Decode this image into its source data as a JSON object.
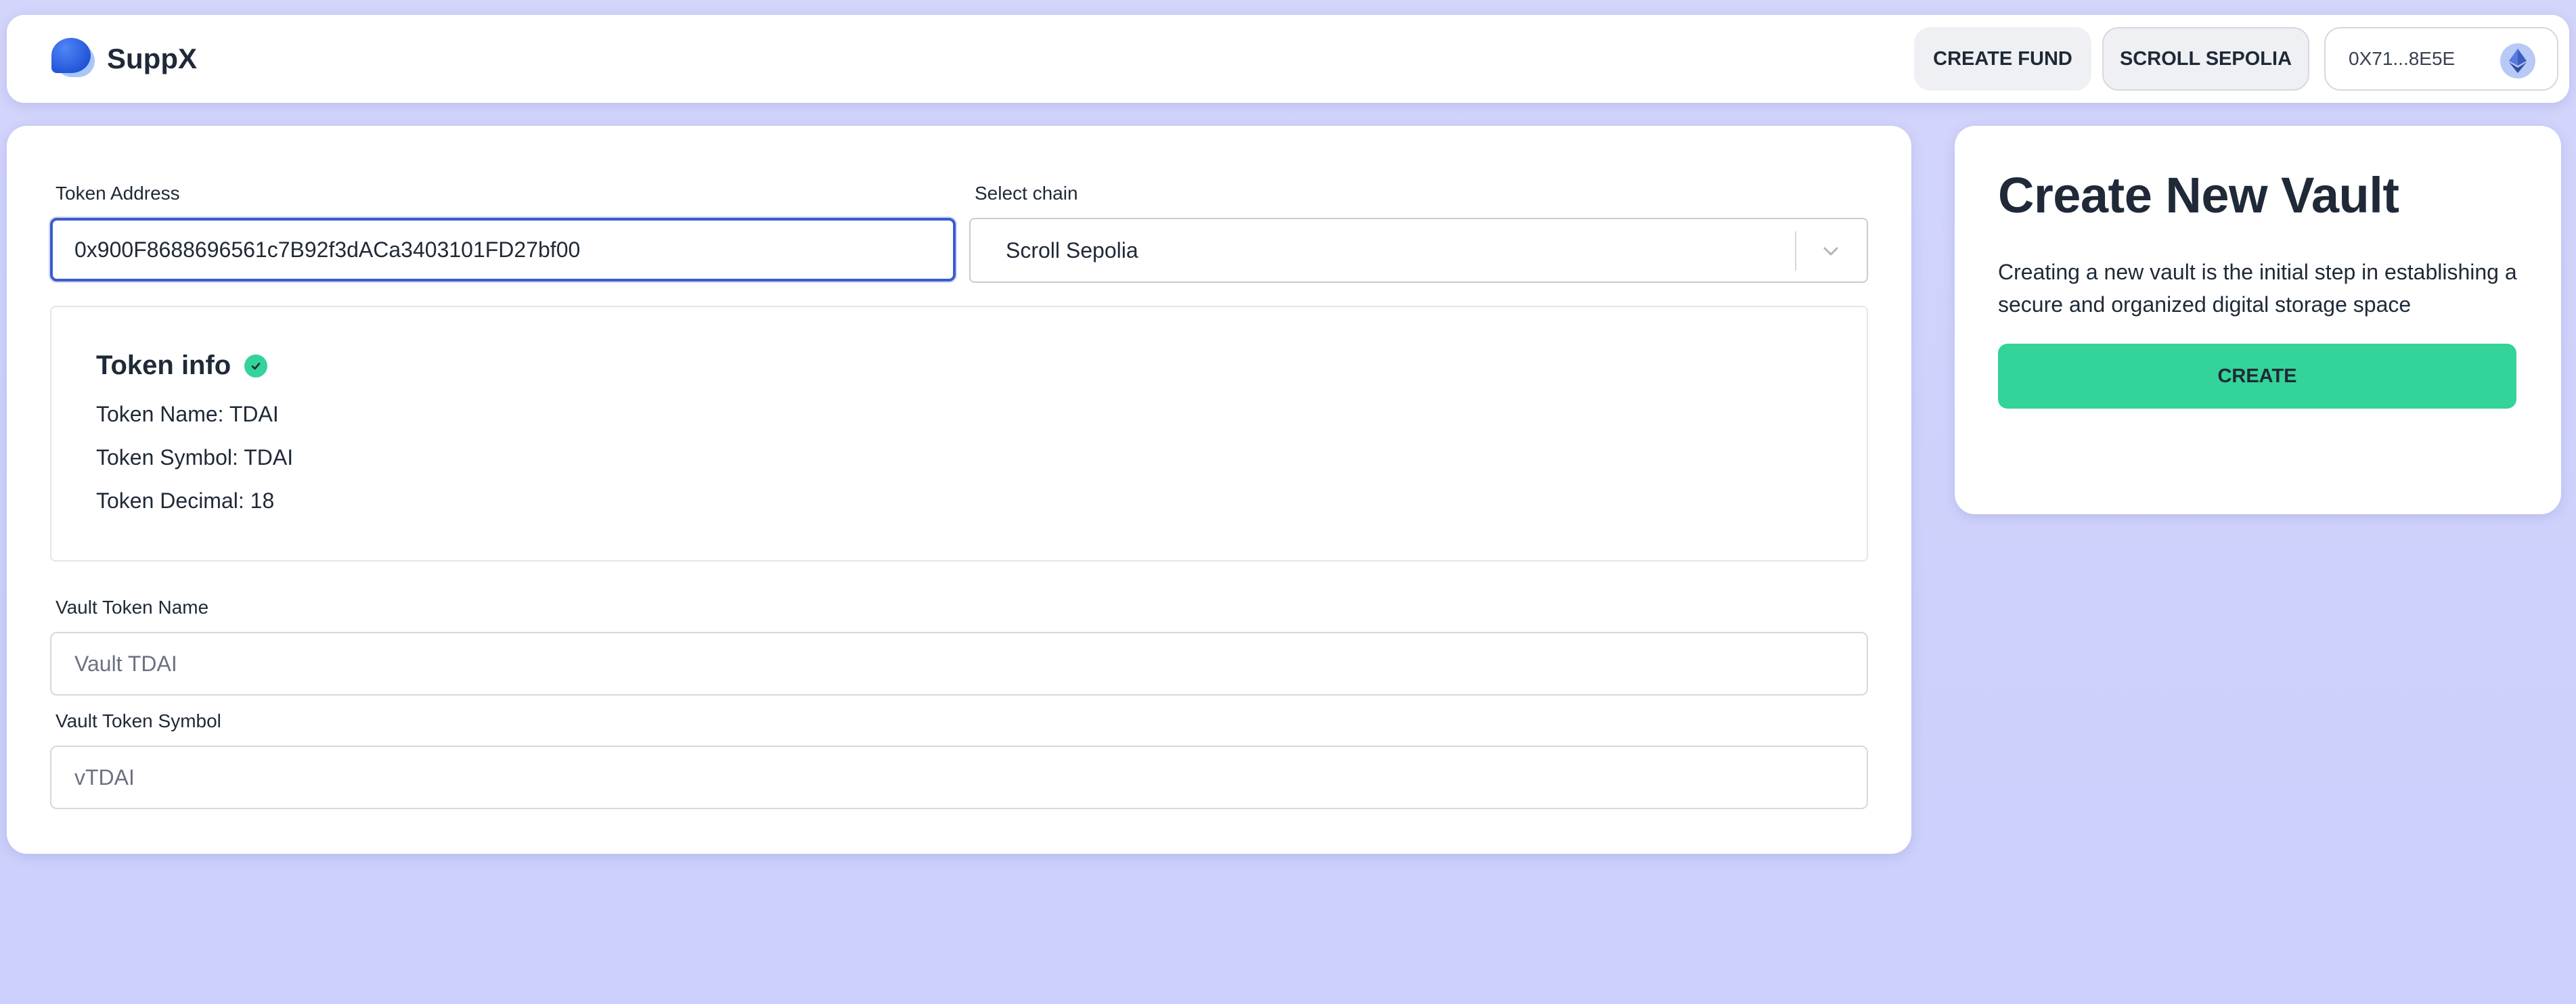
{
  "header": {
    "brand_name": "SuppX",
    "create_fund_label": "CREATE FUND",
    "chain_label": "SCROLL SEPOLIA",
    "account_label": "0X71...8E5E"
  },
  "form": {
    "token_address_label": "Token Address",
    "token_address_value": "0x900F8688696561c7B92f3dACa3403101FD27bf00",
    "select_chain_label": "Select chain",
    "select_chain_value": "Scroll Sepolia",
    "vault_token_name_label": "Vault Token Name",
    "vault_token_name_placeholder": "Vault TDAI",
    "vault_token_symbol_label": "Vault Token Symbol",
    "vault_token_symbol_placeholder": "vTDAI"
  },
  "token_info": {
    "title": "Token info",
    "name_line": "Token Name: TDAI",
    "symbol_line": "Token Symbol: TDAI",
    "decimal_line": "Token Decimal: 18"
  },
  "side": {
    "title": "Create New Vault",
    "description": "Creating a new vault is the initial step in establishing a secure and organized digital storage space",
    "create_label": "CREATE"
  },
  "colors": {
    "accent_green": "#34d399",
    "focus_blue": "#3b5ccc",
    "background": "#cdd1fb"
  },
  "icons": {
    "logo": "suppx-logo-icon",
    "account": "ethereum-avatar-icon",
    "chevron": "chevron-down-icon",
    "check": "check-circle-icon"
  }
}
